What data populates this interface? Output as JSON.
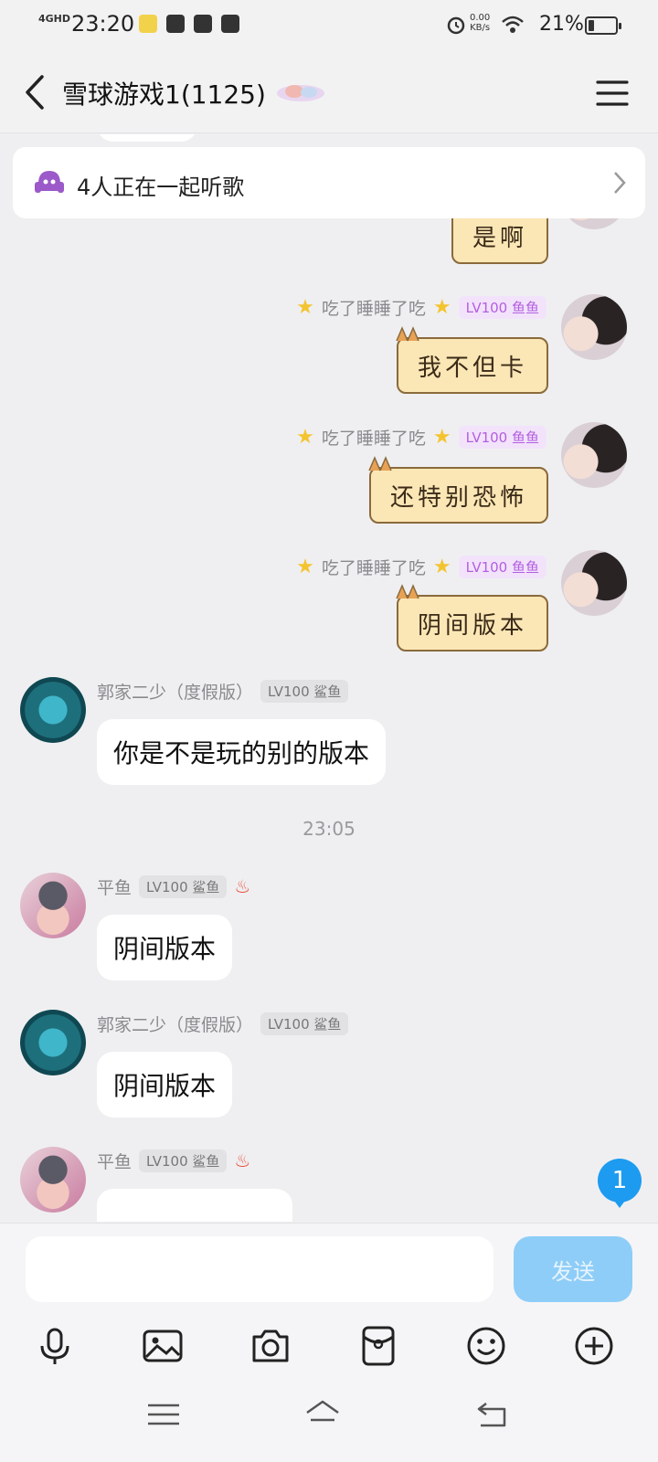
{
  "status": {
    "network": "4GHD",
    "time": "23:20",
    "speed_top": "0.00",
    "speed_bottom": "KB/s",
    "battery_pct": "21%",
    "battery_level": 0.21
  },
  "header": {
    "title": "雪球游戏1(1125)"
  },
  "banner": {
    "text": "4人正在一起听歌"
  },
  "messages": [
    {
      "sender": "",
      "text": "是啊"
    },
    {
      "sender": "吃了睡睡了吃",
      "level": "LV100 鱼鱼",
      "text": "我不但卡"
    },
    {
      "sender": "吃了睡睡了吃",
      "level": "LV100 鱼鱼",
      "text": "还特别恐怖"
    },
    {
      "sender": "吃了睡睡了吃",
      "level": "LV100 鱼鱼",
      "text": "阴间版本"
    },
    {
      "sender": "郭家二少（度假版）",
      "level": "LV100 鲨鱼",
      "text": "你是不是玩的别的版本"
    },
    {
      "sender": "平鱼",
      "level": "LV100 鲨鱼",
      "text": "阴间版本"
    },
    {
      "sender": "郭家二少（度假版）",
      "level": "LV100 鲨鱼",
      "text": "阴间版本"
    },
    {
      "sender": "平鱼",
      "level": "LV100 鲨鱼",
      "text": ""
    }
  ],
  "time_separator": "23:05",
  "unread_count": "1",
  "input": {
    "value": "",
    "send_label": "发送"
  },
  "icons": {
    "toolbar": [
      "microphone-icon",
      "image-icon",
      "camera-icon",
      "red-packet-icon",
      "emoji-icon",
      "plus-icon"
    ],
    "nav": [
      "menu-nav-icon",
      "home-nav-icon",
      "back-nav-icon"
    ]
  },
  "colors": {
    "send_button": "#8ecdf8",
    "unread_badge": "#1d9bf0",
    "level_purple": "#b35fe0",
    "cat_bubble": "#fbe6b5"
  }
}
